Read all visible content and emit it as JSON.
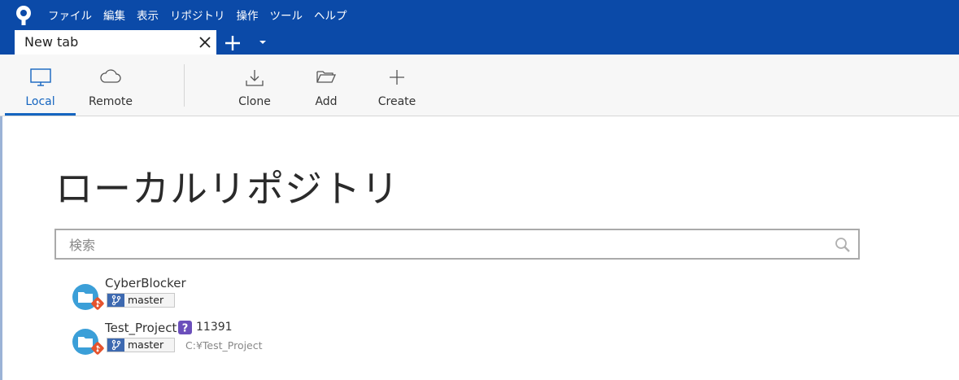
{
  "menu": [
    "ファイル",
    "編集",
    "表示",
    "リポジトリ",
    "操作",
    "ツール",
    "ヘルプ"
  ],
  "tab": {
    "label": "New tab"
  },
  "toolbar": {
    "local": "Local",
    "remote": "Remote",
    "clone": "Clone",
    "add": "Add",
    "create": "Create"
  },
  "page": {
    "title": "ローカルリポジトリ"
  },
  "search": {
    "placeholder": "検索"
  },
  "repos": [
    {
      "name": "CyberBlocker",
      "branch": "master"
    },
    {
      "name": "Test_Project",
      "branch": "master",
      "status_count": "11391",
      "path": "C:¥Test_Project"
    }
  ],
  "colors": {
    "titlebar": "#0b4aa8",
    "accent": "#1565c0",
    "branch_icon": "#3d69b0",
    "status_badge": "#6b4fbb",
    "git_icon": "#e5532d",
    "folder_icon": "#3b9fd8"
  }
}
